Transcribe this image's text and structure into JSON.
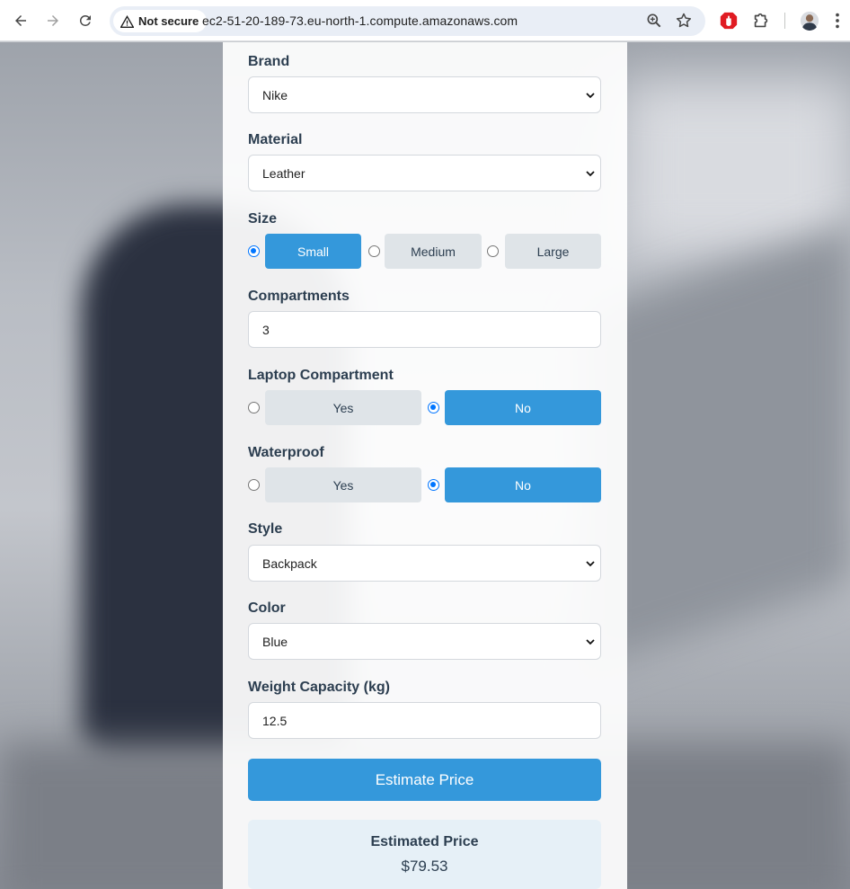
{
  "browser": {
    "security_label": "Not secure",
    "url": "ec2-51-20-189-73.eu-north-1.compute.amazonaws.com",
    "icons": [
      "back-icon",
      "forward-icon",
      "reload-icon",
      "warning-icon",
      "zoom-icon",
      "bookmark-star-icon",
      "adblock-extension-icon",
      "extensions-puzzle-icon",
      "profile-avatar",
      "more-menu-icon"
    ]
  },
  "form": {
    "brand": {
      "label": "Brand",
      "value": "Nike"
    },
    "material": {
      "label": "Material",
      "value": "Leather"
    },
    "size": {
      "label": "Size",
      "options": [
        "Small",
        "Medium",
        "Large"
      ],
      "selected": "Small"
    },
    "compartments": {
      "label": "Compartments",
      "value": "3"
    },
    "laptop": {
      "label": "Laptop Compartment",
      "options": [
        "Yes",
        "No"
      ],
      "selected": "No"
    },
    "waterproof": {
      "label": "Waterproof",
      "options": [
        "Yes",
        "No"
      ],
      "selected": "No"
    },
    "style": {
      "label": "Style",
      "value": "Backpack"
    },
    "color": {
      "label": "Color",
      "value": "Blue"
    },
    "weight": {
      "label": "Weight Capacity (kg)",
      "value": "12.5"
    },
    "submit_label": "Estimate Price"
  },
  "result": {
    "title": "Estimated Price",
    "value": "$79.53"
  },
  "colors": {
    "accent": "#3498db",
    "option_bg": "#dfe4e8",
    "label": "#2c3e50",
    "result_bg": "#e6f0f7"
  }
}
